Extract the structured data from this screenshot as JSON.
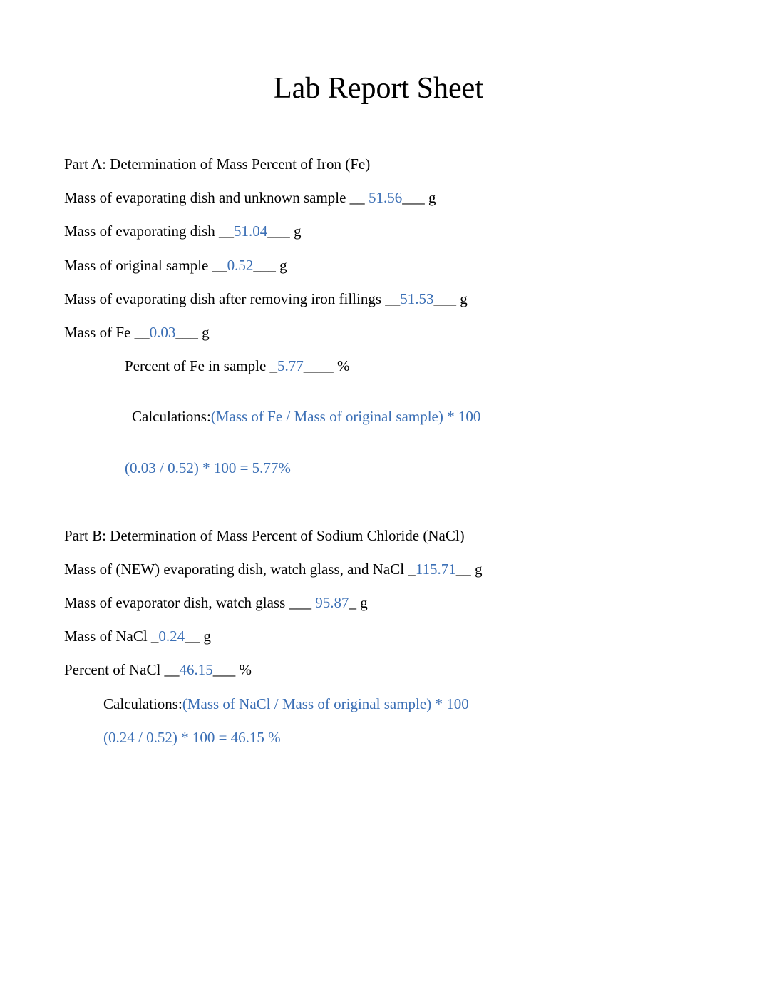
{
  "title": "Lab Report Sheet",
  "partA": {
    "heading": "Part A: Determination of Mass Percent of Iron (Fe)",
    "line1_pre": "Mass of evaporating dish and unknown sample __ ",
    "line1_val": "51.56",
    "line1_post": "___ g",
    "line2_pre": "Mass of evaporating dish __",
    "line2_val": "51.04",
    "line2_post": "___ g",
    "line3_pre": " Mass of original sample __",
    "line3_val": "0.52",
    "line3_post": "___ g",
    "line4_pre": "Mass of evaporating dish after removing iron fillings __",
    "line4_val": "51.53",
    "line4_post": "___ g",
    "line5_pre": " Mass of Fe __",
    "line5_val": "0.03",
    "line5_post": "___ g",
    "line6_pre": "Percent of Fe in sample _",
    "line6_val": "5.77",
    "line6_post": "____ %",
    "calc_label": "Calculations:",
    "calc_formula": "(Mass of Fe / Mass of original sample) * 100",
    "calc_result": "(0.03 / 0.52) * 100 = 5.77%"
  },
  "partB": {
    "heading": "Part B: Determination of Mass Percent of Sodium Chloride (NaCl)",
    "line1_pre": "Mass of (NEW) evaporating dish, watch glass, and NaCl _",
    "line1_val": "115.71",
    "line1_post": "__ g",
    "line2_pre": "Mass of evaporator dish, watch glass ___ ",
    "line2_val": "95.87",
    "line2_post": "_ g",
    "line3_pre": "Mass of NaCl _",
    "line3_val": "0.24",
    "line3_post": "__ g",
    "line4_pre": "Percent of NaCl __",
    "line4_val": "46.15",
    "line4_post": "___ %",
    "calc_label": "Calculations:",
    "calc_formula": "(Mass of NaCl / Mass of original sample) * 100",
    "calc_result": "(0.24 / 0.52) * 100 = 46.15 %"
  }
}
